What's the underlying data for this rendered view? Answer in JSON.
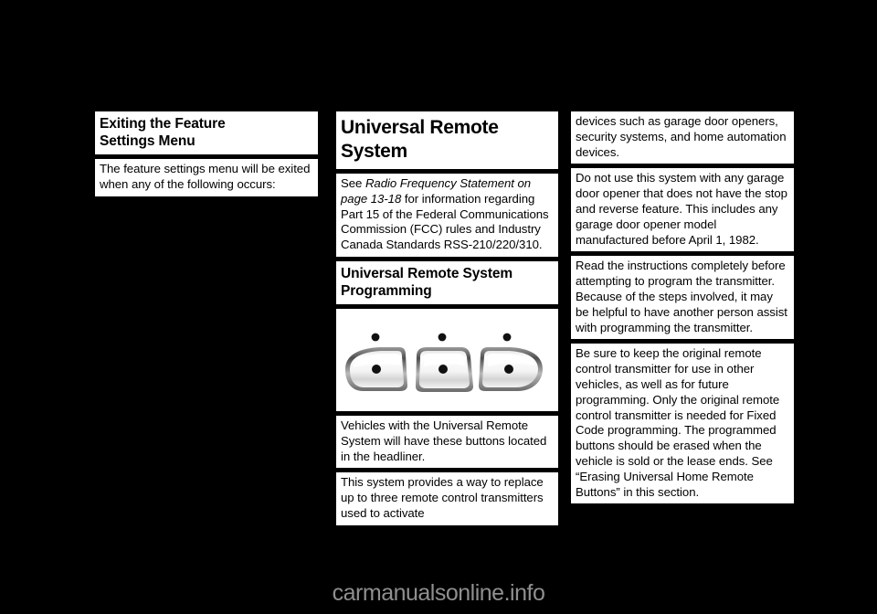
{
  "page": {
    "background_color": "#000000",
    "block_color": "#ffffff",
    "text_color": "#000000",
    "watermark": "carmanualsonline.info",
    "watermark_color": "#8f8f8f"
  },
  "columns": {
    "left": {
      "blocks": [
        {
          "type": "heading",
          "lines": [
            "Exiting the Feature",
            "Settings Menu"
          ]
        },
        {
          "type": "body",
          "text": "The feature settings menu will be exited when any of the following occurs:"
        }
      ]
    },
    "middle": {
      "blocks": [
        {
          "type": "heading-big",
          "lines": [
            "Universal Remote",
            "System"
          ]
        },
        {
          "type": "body",
          "text_before": "See ",
          "text_italic": "Radio Frequency Statement on page 13-18",
          "text_after": " for information regarding Part 15 of the Federal Communications Commission (FCC) rules and Industry Canada Standards RSS-210/220/310."
        },
        {
          "type": "heading",
          "lines": [
            "Universal Remote System",
            "Programming"
          ]
        },
        {
          "type": "figure",
          "name": "headliner-remote-buttons-illustration",
          "button_count": 3,
          "indicator_dots": 3
        },
        {
          "type": "body",
          "text": "Vehicles with the Universal Remote System will have these buttons located in the headliner."
        },
        {
          "type": "body",
          "text": "This system provides a way to replace up to three remote control transmitters used to activate"
        }
      ]
    },
    "right": {
      "blocks": [
        {
          "type": "body",
          "text": "devices such as garage door openers, security systems, and home automation devices."
        },
        {
          "type": "body",
          "text": "Do not use this system with any garage door opener that does not have the stop and reverse feature. This includes any garage door opener model manufactured before April 1, 1982."
        },
        {
          "type": "body",
          "text": "Read the instructions completely before attempting to program the transmitter. Because of the steps involved, it may be helpful to have another person assist with programming the transmitter."
        },
        {
          "type": "body",
          "text": "Be sure to keep the original remote control transmitter for use in other vehicles, as well as for future programming. Only the original remote control transmitter is needed for Fixed Code programming. The programmed buttons should be erased when the vehicle is sold or the lease ends. See “Erasing Universal Home Remote Buttons” in this section."
        }
      ]
    }
  }
}
